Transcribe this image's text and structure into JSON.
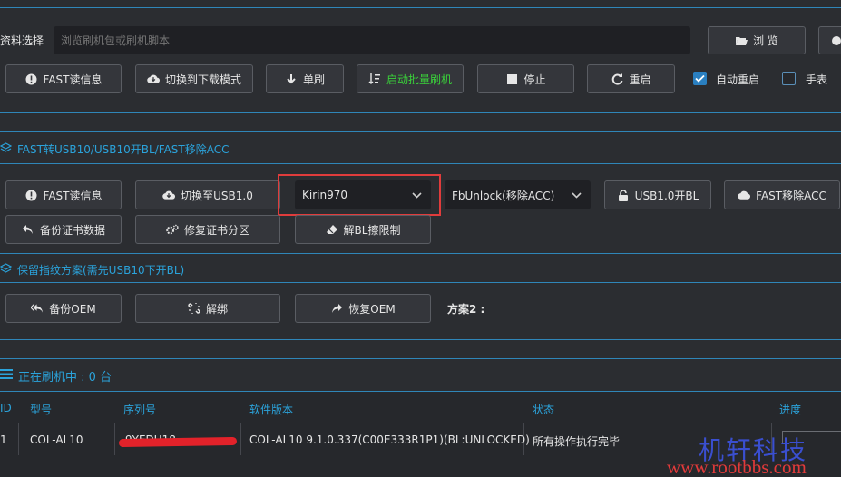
{
  "header": {
    "file_label": "资料选择",
    "file_placeholder": "浏览刷机包或刷机脚本",
    "browse_label": "浏 览"
  },
  "toolbar1": {
    "fast_read": "FAST读信息",
    "switch_download": "切换到下载模式",
    "single_flash": "单刷",
    "batch_flash": "启动批量刷机",
    "stop": "停止",
    "restart": "重启",
    "auto_restart": "自动重启",
    "auto_restart_checked": true,
    "manual": "手表",
    "manual_checked": false
  },
  "section1": {
    "title": "FAST转USB10/USB10开BL/FAST移除ACC",
    "fast_read": "FAST读信息",
    "switch_usb": "切换至USB1.0",
    "chip_select": "Kirin970",
    "unlock_select": "FbUnlock(移除ACC)",
    "usb_open_bl": "USB1.0开BL",
    "fast_remove_acc": "FAST移除ACC",
    "backup_cert": "备份证书数据",
    "repair_cert": "修复证书分区",
    "unlock_bl_limit": "解BL擦限制"
  },
  "section2": {
    "title": "保留指纹方案(需先USB10下开BL)",
    "backup_oem": "备份OEM",
    "unbind": "解绑",
    "restore_oem": "恢复OEM",
    "plan2": "方案2 :"
  },
  "devices": {
    "title": "正在刷机中 : 0 台",
    "columns": {
      "id": "ID",
      "model": "型号",
      "serial": "序列号",
      "version": "软件版本",
      "status": "状态",
      "progress": "进度"
    },
    "rows": [
      {
        "id": "1",
        "model": "COL-AL10",
        "serial": "9YEDU18",
        "version": "COL-AL10 9.1.0.337(C00E333R1P1)(BL:UNLOCKED)",
        "status": "所有操作执行完毕"
      }
    ]
  },
  "watermark": {
    "cn": "机轩科技",
    "url": "www.rootbbs.com"
  },
  "colors": {
    "accent": "#2ba3db",
    "highlight_box": "#e03c3c",
    "batch_text": "#3ad23a"
  }
}
